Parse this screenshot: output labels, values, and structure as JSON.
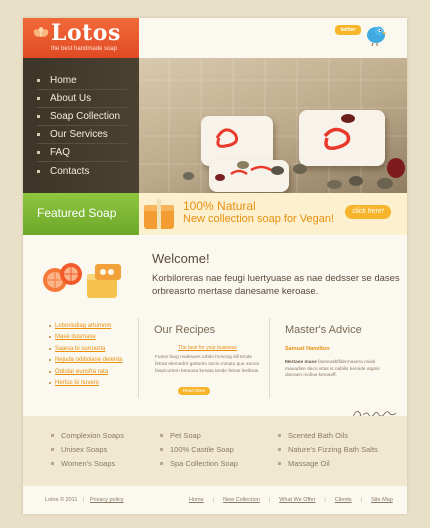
{
  "logo": {
    "name": "Lotos",
    "tagline": "the best handmade soap"
  },
  "social": {
    "twitter_label": "twitter"
  },
  "nav": {
    "items": [
      "Home",
      "About Us",
      "Soap Collection",
      "Our Services",
      "FAQ",
      "Contacts"
    ]
  },
  "featured": {
    "title": "Featured Soap",
    "headline": "100% Natural",
    "subline": "New collection soap for Vegan!",
    "button": "click here!"
  },
  "welcome": {
    "title": "Welcome!",
    "body": "Korbiloreras nae feugi luertyuase as nae dedsser se dases orbreasrto mertase danesame keroase."
  },
  "side_links": [
    "Loborisdiag artumnm",
    "Mase dusmase",
    "Sajesa bi surruorta",
    "Nejuda oditiolase delenta",
    "Odiolar eunsfra rata",
    "Hertus bi nuvero"
  ],
  "recipes": {
    "title": "Our Recipes",
    "subtitle": "The best for your business",
    "body": "Fusce feug malesues orbim hcecing sill tende fetras elemedrir gettorim socio minato que annos faspicurtem keraosa kesata tende fetras lesibras.",
    "button": "Read More"
  },
  "advice": {
    "title": "Master's Advice",
    "name": "Samuel Hamilton",
    "lead": "Mertase mase",
    "body": "fasneaskffdermasera miais mauadise deco vitas is nabilis keroide atgnis dionaen molius keroseff."
  },
  "bottom_links": {
    "col1": [
      "Complexion Soaps",
      "Unisex Soaps",
      "Women's Soaps"
    ],
    "col2": [
      "Pet Soap",
      "100% Castile Soap",
      "Spa Collection Soap"
    ],
    "col3": [
      "Scented Bath Oils",
      "Nature's Fizzing Bath Salts",
      "Massage Oil"
    ]
  },
  "footer": {
    "copyright": "Lotos © 2011",
    "privacy": "Privacy policy",
    "nav": [
      "Home",
      "New Collection",
      "What We Offer",
      "Clients",
      "Site Map"
    ]
  },
  "colors": {
    "brand_orange": "#e04a24",
    "accent_yellow": "#f6b52b",
    "nav_dark": "#3d3527",
    "green": "#6ea82a",
    "text_orange": "#e8900e"
  }
}
